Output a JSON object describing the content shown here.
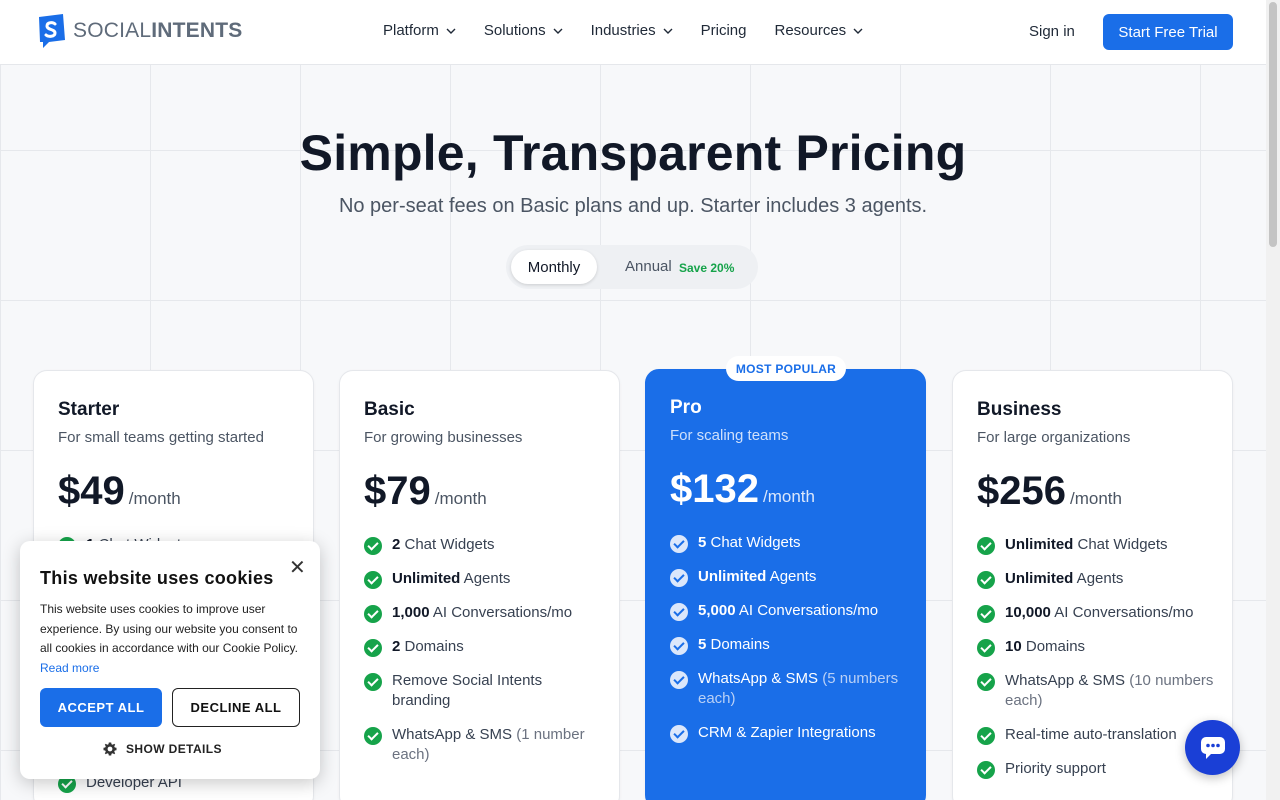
{
  "nav": {
    "logo_prefix": "SOCIAL",
    "logo_suffix": "INTENTS",
    "menu": [
      {
        "label": "Platform",
        "dropdown": true
      },
      {
        "label": "Solutions",
        "dropdown": true
      },
      {
        "label": "Industries",
        "dropdown": true
      },
      {
        "label": "Pricing",
        "dropdown": false
      },
      {
        "label": "Resources",
        "dropdown": true
      }
    ],
    "signin": "Sign in",
    "cta": "Start Free Trial"
  },
  "hero": {
    "title": "Simple, Transparent Pricing",
    "subtitle": "No per-seat fees on Basic plans and up. Starter includes 3 agents.",
    "toggle": {
      "monthly": "Monthly",
      "annual": "Annual",
      "save": "Save 20%",
      "selected": "Monthly"
    }
  },
  "popular_badge": "MOST POPULAR",
  "plans": [
    {
      "name": "Starter",
      "desc": "For small teams getting started",
      "price": "$49",
      "period": "/month",
      "features": [
        {
          "bold": "1",
          "text": " Chat Widget",
          "muted": ""
        }
      ],
      "footer_feature": "Developer API"
    },
    {
      "name": "Basic",
      "desc": "For growing businesses",
      "price": "$79",
      "period": "/month",
      "features": [
        {
          "bold": "2",
          "text": " Chat Widgets",
          "muted": ""
        },
        {
          "bold": "Unlimited",
          "text": " Agents",
          "muted": ""
        },
        {
          "bold": "1,000",
          "text": " AI Conversations/mo",
          "muted": ""
        },
        {
          "bold": "2",
          "text": " Domains",
          "muted": ""
        },
        {
          "bold": "",
          "text": "Remove Social Intents branding",
          "muted": ""
        },
        {
          "bold": "",
          "text": "WhatsApp & SMS ",
          "muted": "(1 number each)"
        }
      ]
    },
    {
      "name": "Pro",
      "desc": "For scaling teams",
      "price": "$132",
      "period": "/month",
      "features": [
        {
          "bold": "5",
          "text": " Chat Widgets",
          "muted": ""
        },
        {
          "bold": "Unlimited",
          "text": " Agents",
          "muted": ""
        },
        {
          "bold": "5,000",
          "text": " AI Conversations/mo",
          "muted": ""
        },
        {
          "bold": "5",
          "text": " Domains",
          "muted": ""
        },
        {
          "bold": "",
          "text": "WhatsApp & SMS ",
          "muted": "(5 numbers each)"
        },
        {
          "bold": "",
          "text": "CRM & Zapier Integrations",
          "muted": ""
        }
      ]
    },
    {
      "name": "Business",
      "desc": "For large organizations",
      "price": "$256",
      "period": "/month",
      "features": [
        {
          "bold": "Unlimited",
          "text": " Chat Widgets",
          "muted": ""
        },
        {
          "bold": "Unlimited",
          "text": " Agents",
          "muted": ""
        },
        {
          "bold": "10,000",
          "text": " AI Conversations/mo",
          "muted": ""
        },
        {
          "bold": "10",
          "text": " Domains",
          "muted": ""
        },
        {
          "bold": "",
          "text": "WhatsApp & SMS ",
          "muted": "(10 numbers each)"
        },
        {
          "bold": "",
          "text": "Real-time auto-translation",
          "muted": ""
        },
        {
          "bold": "",
          "text": "Priority support",
          "muted": ""
        }
      ]
    }
  ],
  "cookie": {
    "title": "This website uses cookies",
    "text": "This website uses cookies to improve user experience. By using our website you consent to all cookies in accordance with our Cookie Policy.",
    "read_more": "Read more",
    "accept": "ACCEPT ALL",
    "decline": "DECLINE ALL",
    "details": "SHOW DETAILS",
    "close": "✕"
  },
  "colors": {
    "brand": "#1a6ee8",
    "check": "#16a34a",
    "chat": "#1a3fd6"
  }
}
